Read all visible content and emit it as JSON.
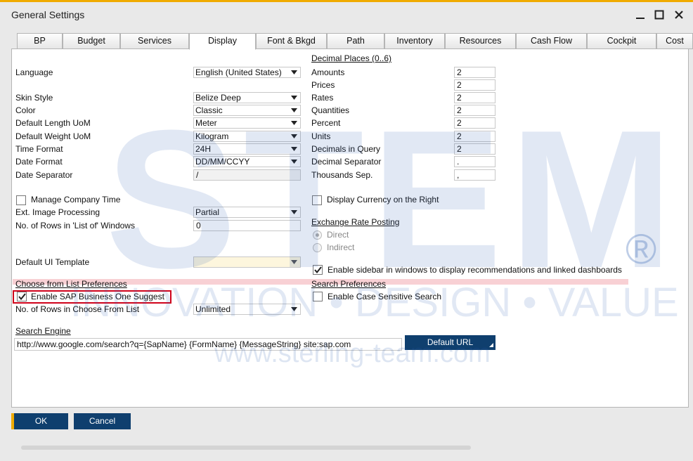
{
  "window": {
    "title": "General Settings",
    "icons": {
      "minimize": "minimize-icon",
      "maximize": "maximize-icon",
      "close": "close-icon"
    }
  },
  "tabs": [
    {
      "label": "BP",
      "active": false
    },
    {
      "label": "Budget",
      "active": false
    },
    {
      "label": "Services",
      "active": false
    },
    {
      "label": "Display",
      "active": true
    },
    {
      "label": "Font & Bkgd",
      "active": false
    },
    {
      "label": "Path",
      "active": false
    },
    {
      "label": "Inventory",
      "active": false
    },
    {
      "label": "Resources",
      "active": false
    },
    {
      "label": "Cash Flow",
      "active": false
    },
    {
      "label": "Cockpit",
      "active": false
    },
    {
      "label": "Cost",
      "active": false
    }
  ],
  "left": {
    "language": {
      "label": "Language",
      "value": "English (United States)"
    },
    "skin_style": {
      "label": "Skin Style",
      "value": "Belize Deep"
    },
    "color": {
      "label": "Color",
      "value": "Classic"
    },
    "length_uom": {
      "label": "Default Length UoM",
      "value": "Meter"
    },
    "weight_uom": {
      "label": "Default Weight UoM",
      "value": "Kilogram"
    },
    "time_format": {
      "label": "Time Format",
      "value": "24H"
    },
    "date_format": {
      "label": "Date Format",
      "value": "DD/MM/CCYY"
    },
    "date_separator": {
      "label": "Date Separator",
      "value": "/"
    },
    "manage_company_time": {
      "label": "Manage Company Time",
      "checked": false
    },
    "ext_image": {
      "label": "Ext. Image Processing",
      "value": "Partial"
    },
    "rows_list_of": {
      "label": "No. of Rows in 'List of' Windows",
      "value": "0"
    },
    "ui_template": {
      "label": "Default UI Template",
      "value": ""
    },
    "cfl_header": "Choose from List Preferences",
    "enable_suggest": {
      "label": "Enable SAP Business One Suggest",
      "checked": true
    },
    "rows_cfl": {
      "label": "No. of Rows in Choose From List",
      "value": "Unlimited"
    },
    "search_engine_header": "Search Engine",
    "search_engine_url": "http://www.google.com/search?q={SapName} {FormName} {MessageString} site:sap.com",
    "default_url_label": "Default URL"
  },
  "right": {
    "decimal_header": "Decimal Places  (0..6)",
    "decimals": [
      {
        "label": "Amounts",
        "value": "2"
      },
      {
        "label": "Prices",
        "value": "2"
      },
      {
        "label": "Rates",
        "value": "2"
      },
      {
        "label": "Quantities",
        "value": "2"
      },
      {
        "label": "Percent",
        "value": "2"
      },
      {
        "label": "Units",
        "value": "2"
      },
      {
        "label": "Decimals in Query",
        "value": "2"
      },
      {
        "label": "Decimal Separator",
        "value": "."
      },
      {
        "label": "Thousands Sep.",
        "value": ","
      }
    ],
    "display_currency_right": {
      "label": "Display Currency on the Right",
      "checked": false
    },
    "exchange_header": "Exchange Rate Posting",
    "direct": {
      "label": "Direct",
      "selected": true
    },
    "indirect": {
      "label": "Indirect",
      "selected": false
    },
    "enable_sidebar": {
      "label": "Enable sidebar in windows to display recommendations and linked dashboards",
      "checked": true
    },
    "search_pref_header": "Search Preferences",
    "case_sensitive": {
      "label": "Enable Case Sensitive Search",
      "checked": false
    }
  },
  "buttons": {
    "ok": "OK",
    "cancel": "Cancel"
  },
  "watermark": {
    "big": "STEM",
    "registered": "®",
    "tagline": "INNOVATION • DESIGN • VALUE",
    "url": "www.sterling-team.com"
  },
  "colors": {
    "accent": "#f0ab00",
    "button": "#0f3f6e",
    "highlight": "#d0021b"
  }
}
